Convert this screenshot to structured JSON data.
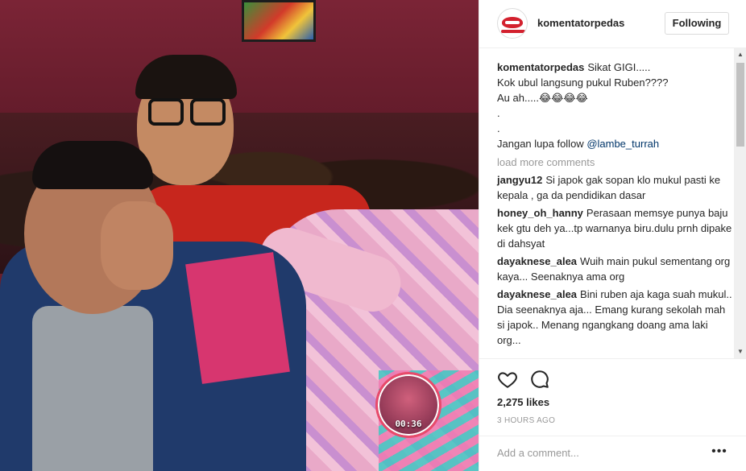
{
  "media": {
    "watermark_time": "00:36"
  },
  "header": {
    "username": "komentatorpedas",
    "follow_label": "Following"
  },
  "caption": {
    "username": "komentatorpedas",
    "lines": [
      "Sikat GIGI.....",
      "Kok ubul langsung pukul Ruben????",
      "Au ah.....😂😂😂😂",
      ".",
      "."
    ],
    "mention_prefix": "Jangan lupa follow ",
    "mention": "@lambe_turrah"
  },
  "load_more": "load more comments",
  "comments": [
    {
      "username": "jangyu12",
      "text": "Si japok gak sopan klo mukul pasti ke kepala , ga da pendidikan dasar"
    },
    {
      "username": "honey_oh_hanny",
      "text": "Perasaan memsye punya baju kek gtu deh ya...tp warnanya biru.dulu prnh dipake di dahsyat"
    },
    {
      "username": "dayaknese_alea",
      "text": "Wuih main pukul sementang org kaya... Seenaknya ama org"
    },
    {
      "username": "dayaknese_alea",
      "text": "Bini ruben aja kaga suah mukul.. Dia seenaknya aja... Emang kurang sekolah mah si japok.. Menang ngangkang doang ama laki org..."
    }
  ],
  "actions": {
    "like_icon": "heart-icon",
    "comment_icon": "comment-icon",
    "likes": "2,275 likes",
    "time": "3 HOURS AGO"
  },
  "add_comment": {
    "placeholder": "Add a comment...",
    "more_label": "•••"
  },
  "colors": {
    "text": "#262626",
    "muted": "#999999",
    "mention": "#003569",
    "border": "#efefef",
    "logo_red": "#d3212e"
  }
}
